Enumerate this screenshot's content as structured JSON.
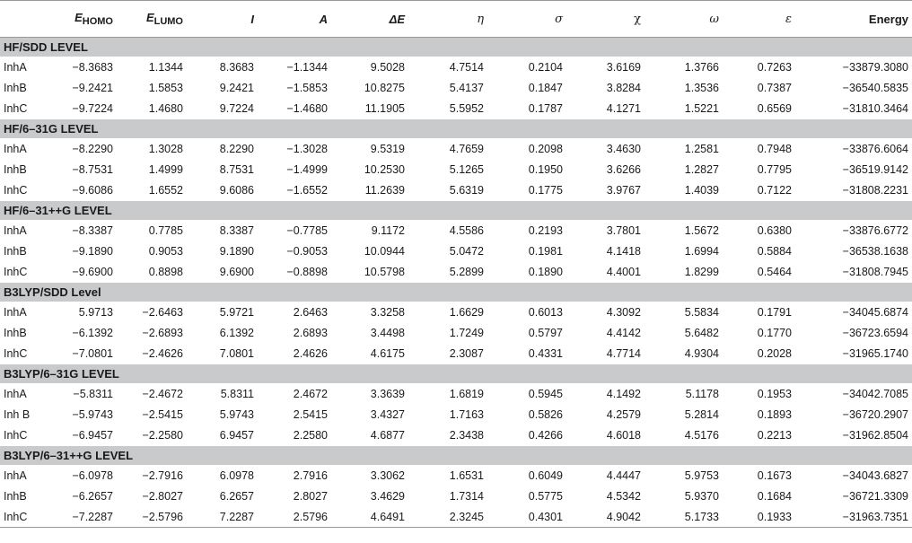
{
  "table": {
    "headers": [
      {
        "main": "",
        "sub": ""
      },
      {
        "main": "E",
        "sub": "HOMO"
      },
      {
        "main": "E",
        "sub": "LUMO"
      },
      {
        "main": "I",
        "sub": ""
      },
      {
        "main": "A",
        "sub": ""
      },
      {
        "main": "ΔE",
        "sub": ""
      },
      {
        "main": "η",
        "sub": ""
      },
      {
        "main": "σ",
        "sub": ""
      },
      {
        "main": "χ",
        "sub": ""
      },
      {
        "main": "ω",
        "sub": ""
      },
      {
        "main": "ε",
        "sub": ""
      },
      {
        "main": "Energy",
        "sub": ""
      }
    ],
    "sections": [
      {
        "title": "HF/SDD LEVEL",
        "rows": [
          [
            "InhA",
            "−8.3683",
            "1.1344",
            "8.3683",
            "−1.1344",
            "9.5028",
            "4.7514",
            "0.2104",
            "3.6169",
            "1.3766",
            "0.7263",
            "−33879.3080"
          ],
          [
            "InhB",
            "−9.2421",
            "1.5853",
            "9.2421",
            "−1.5853",
            "10.8275",
            "5.4137",
            "0.1847",
            "3.8284",
            "1.3536",
            "0.7387",
            "−36540.5835"
          ],
          [
            "InhC",
            "−9.7224",
            "1.4680",
            "9.7224",
            "−1.4680",
            "11.1905",
            "5.5952",
            "0.1787",
            "4.1271",
            "1.5221",
            "0.6569",
            "−31810.3464"
          ]
        ]
      },
      {
        "title": "HF/6–31G LEVEL",
        "rows": [
          [
            "InhA",
            "−8.2290",
            "1.3028",
            "8.2290",
            "−1.3028",
            "9.5319",
            "4.7659",
            "0.2098",
            "3.4630",
            "1.2581",
            "0.7948",
            "−33876.6064"
          ],
          [
            "InhB",
            "−8.7531",
            "1.4999",
            "8.7531",
            "−1.4999",
            "10.2530",
            "5.1265",
            "0.1950",
            "3.6266",
            "1.2827",
            "0.7795",
            "−36519.9142"
          ],
          [
            "InhC",
            "−9.6086",
            "1.6552",
            "9.6086",
            "−1.6552",
            "11.2639",
            "5.6319",
            "0.1775",
            "3.9767",
            "1.4039",
            "0.7122",
            "−31808.2231"
          ]
        ]
      },
      {
        "title": "HF/6–31++G LEVEL",
        "rows": [
          [
            "InhA",
            "−8.3387",
            "0.7785",
            "8.3387",
            "−0.7785",
            "9.1172",
            "4.5586",
            "0.2193",
            "3.7801",
            "1.5672",
            "0.6380",
            "−33876.6772"
          ],
          [
            "InhB",
            "−9.1890",
            "0.9053",
            "9.1890",
            "−0.9053",
            "10.0944",
            "5.0472",
            "0.1981",
            "4.1418",
            "1.6994",
            "0.5884",
            "−36538.1638"
          ],
          [
            "InhC",
            "−9.6900",
            "0.8898",
            "9.6900",
            "−0.8898",
            "10.5798",
            "5.2899",
            "0.1890",
            "4.4001",
            "1.8299",
            "0.5464",
            "−31808.7945"
          ]
        ]
      },
      {
        "title": "B3LYP/SDD Level",
        "rows": [
          [
            "InhA",
            "5.9713",
            "−2.6463",
            "5.9721",
            "2.6463",
            "3.3258",
            "1.6629",
            "0.6013",
            "4.3092",
            "5.5834",
            "0.1791",
            "−34045.6874"
          ],
          [
            "InhB",
            "−6.1392",
            "−2.6893",
            "6.1392",
            "2.6893",
            "3.4498",
            "1.7249",
            "0.5797",
            "4.4142",
            "5.6482",
            "0.1770",
            "−36723.6594"
          ],
          [
            "InhC",
            "−7.0801",
            "−2.4626",
            "7.0801",
            "2.4626",
            "4.6175",
            "2.3087",
            "0.4331",
            "4.7714",
            "4.9304",
            "0.2028",
            "−31965.1740"
          ]
        ]
      },
      {
        "title": "B3LYP/6–31G LEVEL",
        "rows": [
          [
            "InhA",
            "−5.8311",
            "−2.4672",
            "5.8311",
            "2.4672",
            "3.3639",
            "1.6819",
            "0.5945",
            "4.1492",
            "5.1178",
            "0.1953",
            "−34042.7085"
          ],
          [
            "Inh B",
            "−5.9743",
            "−2.5415",
            "5.9743",
            "2.5415",
            "3.4327",
            "1.7163",
            "0.5826",
            "4.2579",
            "5.2814",
            "0.1893",
            "−36720.2907"
          ],
          [
            "InhC",
            "−6.9457",
            "−2.2580",
            "6.9457",
            "2.2580",
            "4.6877",
            "2.3438",
            "0.4266",
            "4.6018",
            "4.5176",
            "0.2213",
            "−31962.8504"
          ]
        ]
      },
      {
        "title": "B3LYP/6–31++G LEVEL",
        "rows": [
          [
            "InhA",
            "−6.0978",
            "−2.7916",
            "6.0978",
            "2.7916",
            "3.3062",
            "1.6531",
            "0.6049",
            "4.4447",
            "5.9753",
            "0.1673",
            "−34043.6827"
          ],
          [
            "InhB",
            "−6.2657",
            "−2.8027",
            "6.2657",
            "2.8027",
            "3.4629",
            "1.7314",
            "0.5775",
            "4.5342",
            "5.9370",
            "0.1684",
            "−36721.3309"
          ],
          [
            "InhC",
            "−7.2287",
            "−2.5796",
            "7.2287",
            "2.5796",
            "4.6491",
            "2.3245",
            "0.4301",
            "4.9042",
            "5.1733",
            "0.1933",
            "−31963.7351"
          ]
        ]
      }
    ]
  }
}
